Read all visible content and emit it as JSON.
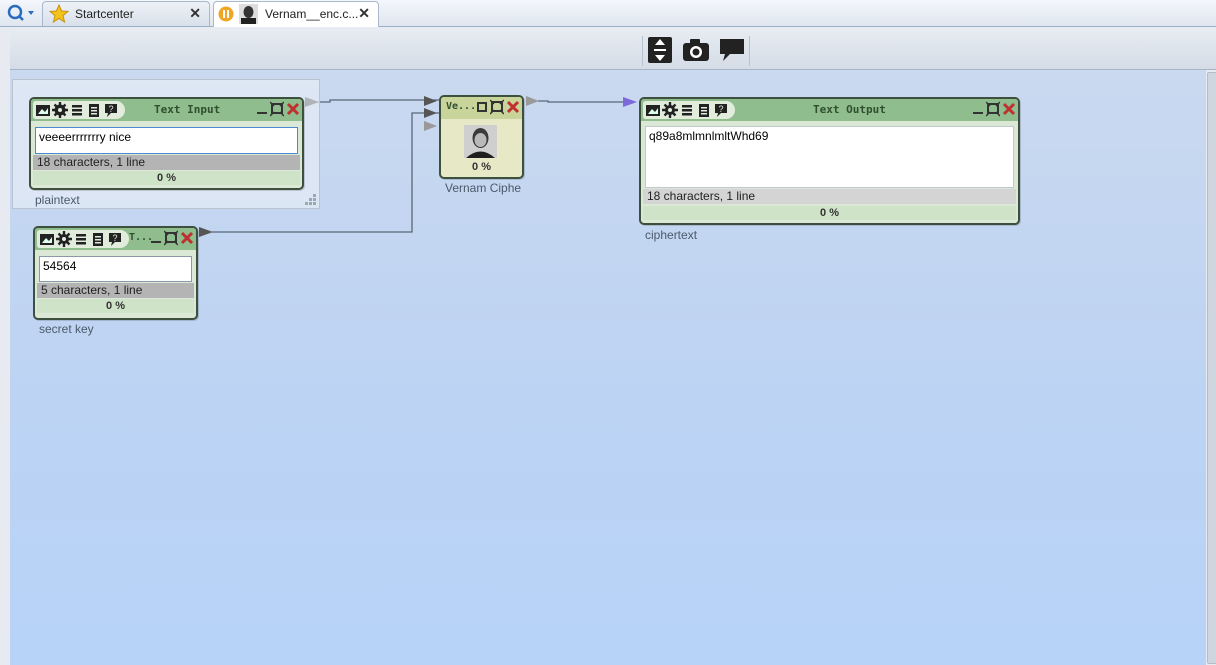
{
  "tabs": [
    {
      "label": "Startcenter",
      "icon": "star-icon"
    },
    {
      "label": "Vernam__enc.c...",
      "icon": "portrait-icon",
      "status_icon": "pause-icon"
    }
  ],
  "toolbar": {
    "buttons": [
      "fit-to-screen-icon",
      "camera-icon",
      "speech-bubble-icon"
    ]
  },
  "text_input": {
    "title": "Text Input",
    "value": "veeeerrrrrrry nice",
    "status": "18 characters,  1 line",
    "progress": "0 %",
    "caption": "plaintext"
  },
  "secret_key": {
    "title": "T...",
    "value": "54564",
    "status": "5 characters,  1 line",
    "progress": "0 %",
    "caption": "secret key"
  },
  "vernam": {
    "title": "Ve...",
    "progress": "0 %",
    "caption": "Vernam Ciphe"
  },
  "text_output": {
    "title": "Text Output",
    "value": "q89a8mlmnlmltWhd69",
    "status": "18 characters,  1 line",
    "progress": "0 %",
    "caption": "ciphertext"
  },
  "colors": {
    "plugin_header": "#8fbd8d",
    "plugin_border": "#3d4f3d",
    "workspace": "#bcd3f3",
    "connector": "#596878"
  }
}
